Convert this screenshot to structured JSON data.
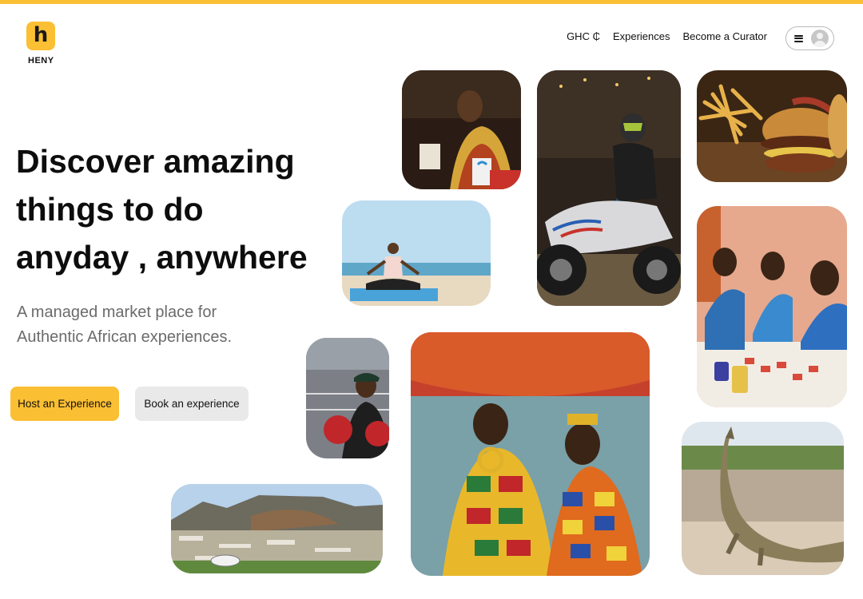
{
  "brand": {
    "logo_letter": "h",
    "name": "HENY",
    "accent": "#fbbf33"
  },
  "nav": {
    "currency": "GHC ₵",
    "experiences": "Experiences",
    "curator": "Become a Curator"
  },
  "hero": {
    "headline_line1": "Discover amazing",
    "headline_line2": "things to do",
    "headline_line3": "anyday , anywhere",
    "sub_line1": "A managed market place for",
    "sub_line2": "Authentic African experiences.",
    "host_button": "Host an Experience",
    "book_button": "Book an experience"
  },
  "icons": {
    "menu": "hamburger-icon",
    "user": "user-avatar-icon"
  }
}
